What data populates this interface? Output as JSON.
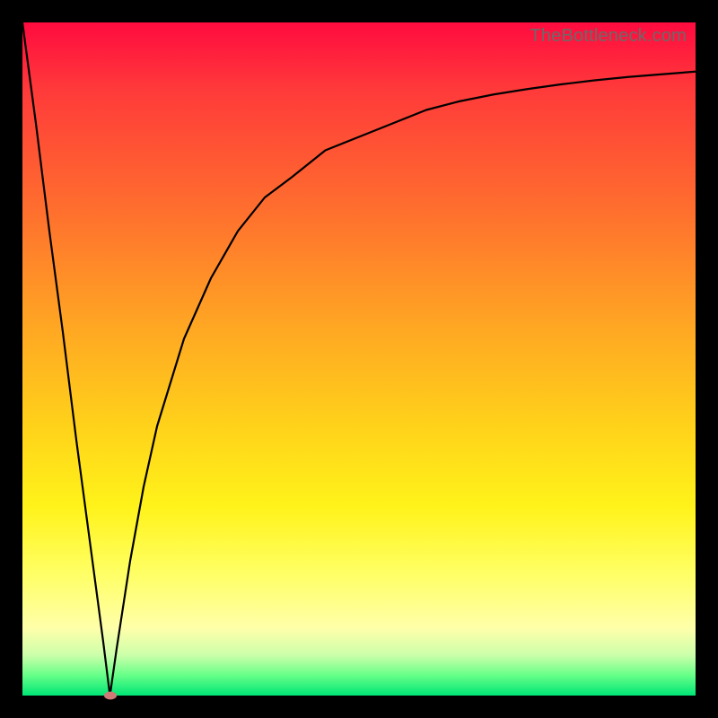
{
  "watermark": "TheBottleneck.com",
  "colors": {
    "frame": "#000000",
    "curve": "#000000",
    "marker": "#cf7a76",
    "gradient_top": "#ff0b3f",
    "gradient_bottom": "#00e676"
  },
  "chart_data": {
    "type": "line",
    "title": "",
    "xlabel": "",
    "ylabel": "",
    "xlim": [
      0,
      100
    ],
    "ylim": [
      0,
      100
    ],
    "grid": false,
    "legend": false,
    "annotations": [
      {
        "text": "TheBottleneck.com",
        "pos": "top-right"
      }
    ],
    "marker": {
      "x": 13,
      "y": 0
    },
    "series": [
      {
        "name": "curve",
        "x": [
          0,
          2,
          4,
          6,
          8,
          10,
          12,
          13,
          14,
          16,
          18,
          20,
          24,
          28,
          32,
          36,
          40,
          45,
          50,
          55,
          60,
          65,
          70,
          75,
          80,
          85,
          90,
          95,
          100
        ],
        "y": [
          100,
          85,
          69,
          54,
          38,
          23,
          8,
          0,
          7,
          20,
          31,
          40,
          53,
          62,
          69,
          74,
          77,
          81,
          83,
          85,
          87,
          88.3,
          89.3,
          90.1,
          90.8,
          91.4,
          91.9,
          92.3,
          92.7
        ]
      }
    ]
  }
}
